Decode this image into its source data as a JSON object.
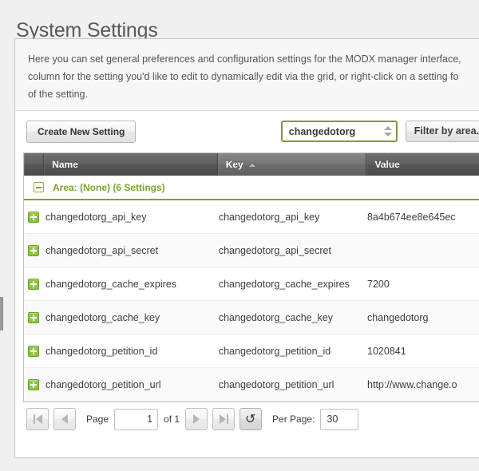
{
  "page": {
    "title": "System Settings"
  },
  "description": {
    "line1": "Here you can set general preferences and configuration settings for the MODX manager interface,",
    "line2": "column for the setting you'd like to edit to dynamically edit via the grid, or right-click on a setting fo",
    "line3": "of the setting."
  },
  "toolbar": {
    "create_button": "Create New Setting",
    "namespace_combo_value": "changedotorg",
    "area_filter_label": "Filter by area..."
  },
  "grid": {
    "columns": {
      "name": "Name",
      "key": "Key",
      "value": "Value"
    },
    "sorted_column": "key",
    "sort_direction": "asc",
    "group": {
      "label": "Area: (None) (6 Settings)",
      "expanded": true
    },
    "rows": [
      {
        "name": "changedotorg_api_key",
        "key": "changedotorg_api_key",
        "value": "8a4b674ee8e645ec"
      },
      {
        "name": "changedotorg_api_secret",
        "key": "changedotorg_api_secret",
        "value": ""
      },
      {
        "name": "changedotorg_cache_expires",
        "key": "changedotorg_cache_expires",
        "value": "7200"
      },
      {
        "name": "changedotorg_cache_key",
        "key": "changedotorg_cache_key",
        "value": "changedotorg"
      },
      {
        "name": "changedotorg_petition_id",
        "key": "changedotorg_petition_id",
        "value": "1020841"
      },
      {
        "name": "changedotorg_petition_url",
        "key": "changedotorg_petition_url",
        "value": "http://www.change.o"
      }
    ]
  },
  "pager": {
    "first_label": "first-page",
    "prev_label": "previous-page",
    "page_label": "Page",
    "page_value": "1",
    "of_label": "of 1",
    "next_label": "next-page",
    "last_label": "last-page",
    "refresh_label": "refresh",
    "refresh_glyph": "↻",
    "per_page_label": "Per Page:",
    "per_page_value": "30"
  },
  "colors": {
    "accent_green": "#7ba528",
    "icon_green": "#8cc63e",
    "header_dark": "#5a5a5a",
    "title_gray": "#595959"
  }
}
